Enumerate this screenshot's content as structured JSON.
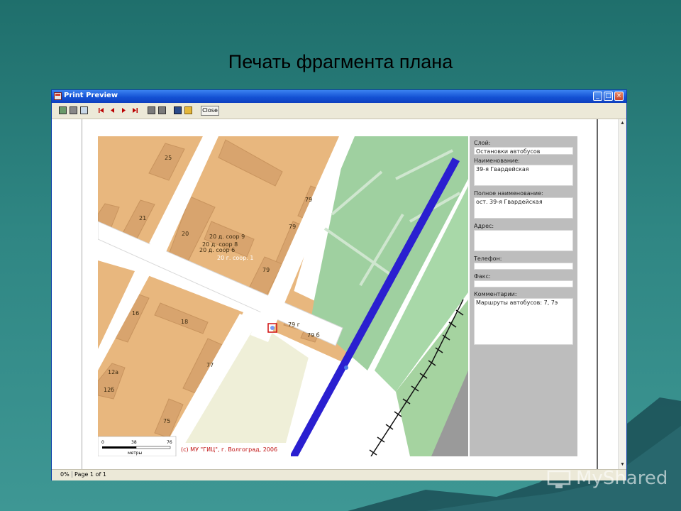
{
  "slide": {
    "title": "Печать фрагмента плана"
  },
  "window": {
    "title": "Print Preview",
    "controls": {
      "minimize": "_",
      "maximize": "□",
      "close": "×"
    },
    "toolbar": {
      "close_label": "Close"
    },
    "status": {
      "zoom": "0%",
      "page": "Page 1 of 1"
    }
  },
  "map": {
    "building_labels": [
      "25",
      "21",
      "20",
      "20 д. соор 9",
      "20 д. соор 8",
      "20 д. соор 6",
      "20 г. соор. 1",
      "79",
      "79",
      "79",
      "16",
      "18",
      "12а",
      "12б",
      "77",
      "75",
      "79 г",
      "79 б"
    ],
    "scale": {
      "ticks": [
        "0",
        "38",
        "76"
      ],
      "unit": "метры"
    },
    "copyright": "(с) МУ \"ГИЦ\", г. Волгоград, 2006",
    "colors": {
      "building": "#d8a46e",
      "block": "#e8b77e",
      "park": "#9fd0a0",
      "road": "#ffffff",
      "rail": "#2a1fd0",
      "water": "#9a9a9a"
    }
  },
  "info_panel": {
    "layer_label": "Слой:",
    "layer_value": "Остановки автобусов",
    "name_label": "Наименование:",
    "name_value": "39-я Гвардейская",
    "full_name_label": "Полное наименование:",
    "full_name_value": "ост. 39-я Гвардейская",
    "address_label": "Адрес:",
    "address_value": "",
    "phone_label": "Телефон:",
    "phone_value": "",
    "fax_label": "Факс:",
    "fax_value": "",
    "comments_label": "Комментарии:",
    "comments_value": "Маршруты автобусов: 7, 7э"
  },
  "watermark": {
    "text": "MyShared",
    "icon": "monitor-icon"
  }
}
